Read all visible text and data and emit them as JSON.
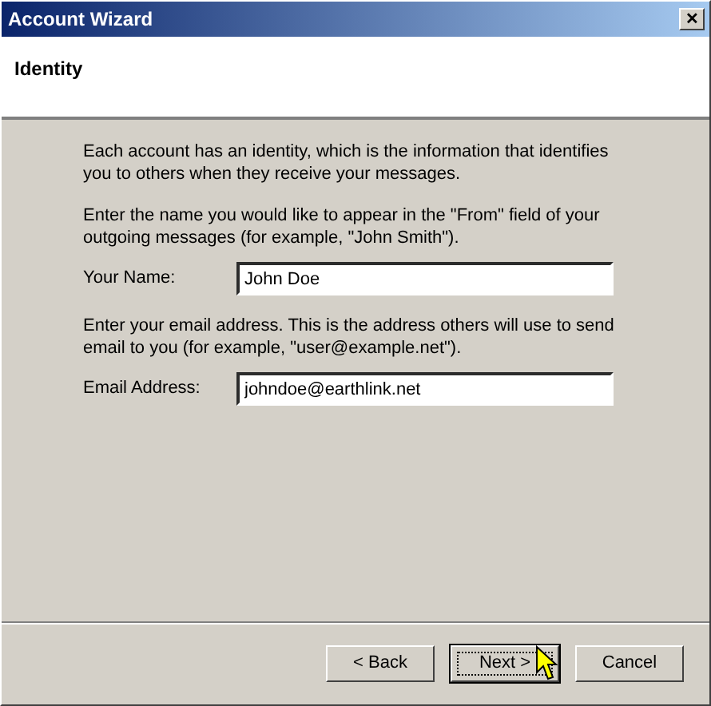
{
  "window": {
    "title": "Account Wizard",
    "close": "✕"
  },
  "page": {
    "title": "Identity"
  },
  "paragraphs": [
    {
      "text": "Each account has an identity, which is the information that identifies you to others when they receive your messages."
    },
    {
      "text": "Enter the name you would like to appear in the \"From\" field of your outgoing messages (for example, \"John Smith\").",
      "field": {
        "label": "Your Name:",
        "value": "John Doe"
      }
    },
    {
      "text": "Enter your email address. This is the address others will use to send email to you (for example, \"user@example.net\").",
      "field": {
        "label": "Email Address:",
        "value": "johndoe@earthlink.net"
      }
    }
  ],
  "buttons": [
    {
      "label": "< Back",
      "focused": false
    },
    {
      "label": "Next >",
      "focused": true
    },
    {
      "label": "Cancel",
      "focused": false
    }
  ]
}
